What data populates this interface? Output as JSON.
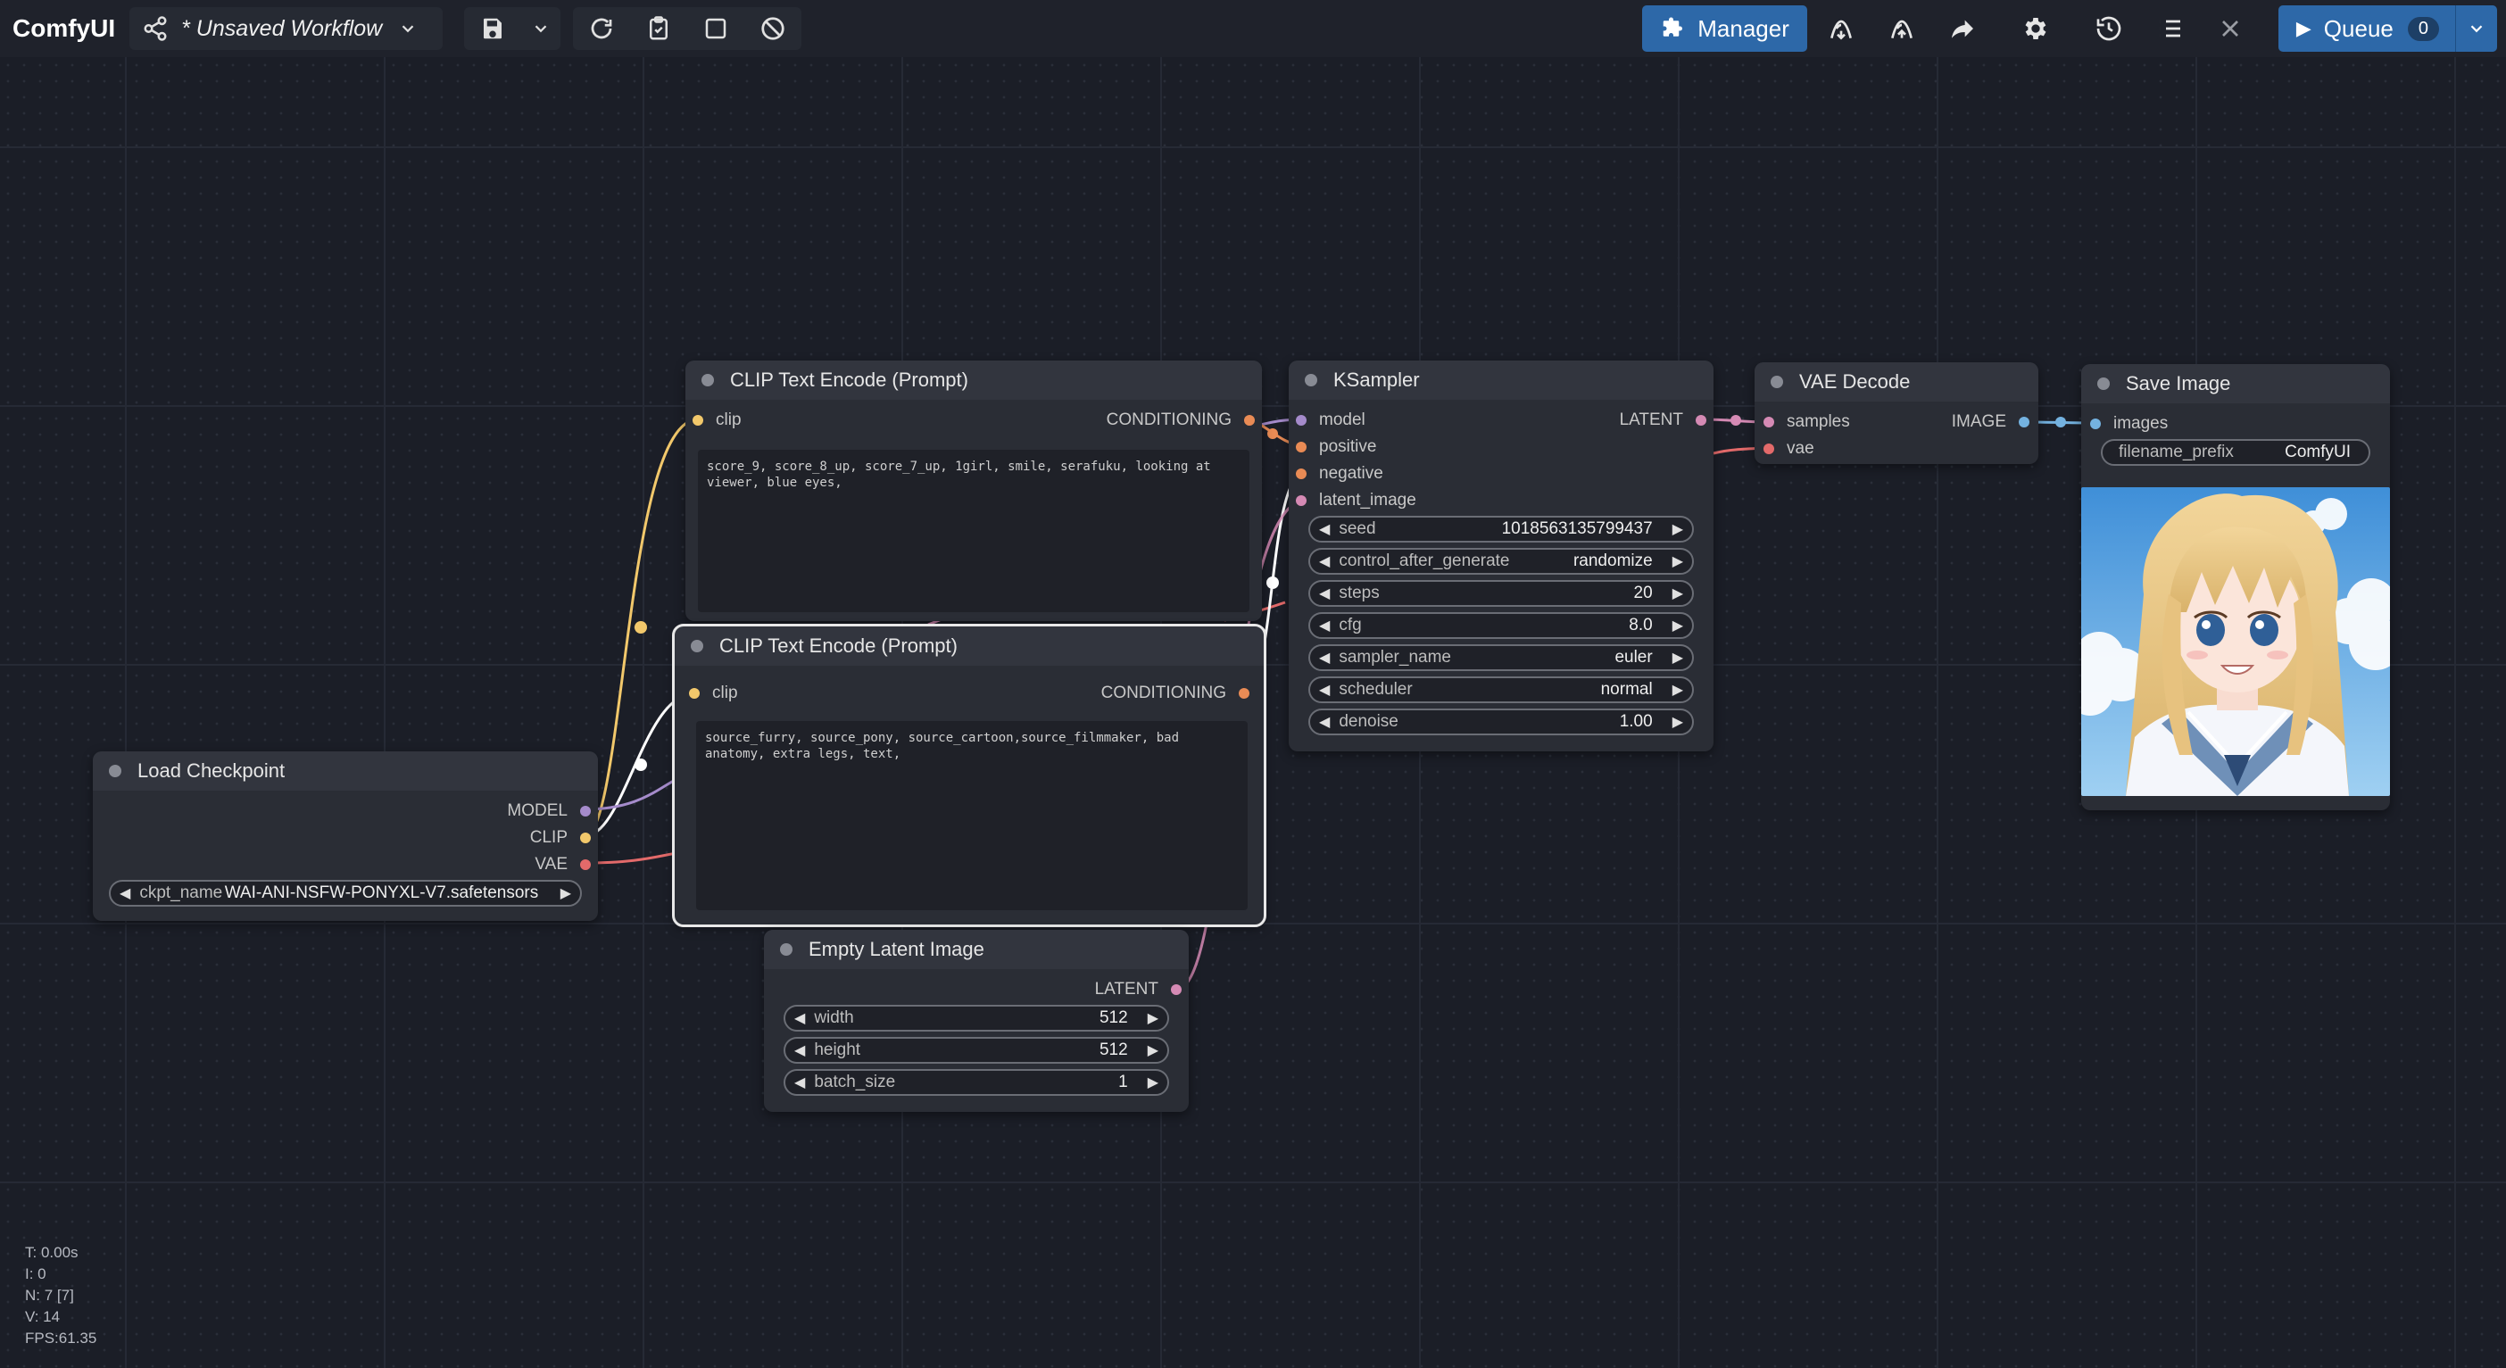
{
  "app": {
    "title": "ComfyUI"
  },
  "toolbar": {
    "workflow_name": "* Unsaved Workflow",
    "manager_label": "Manager",
    "queue_label": "Queue",
    "queue_count": "0",
    "icons": [
      "share-icon",
      "save-icon",
      "chevron-down-icon",
      "refresh-icon",
      "clipboard-icon",
      "fit-view-icon",
      "clear-icon",
      "puzzle-icon",
      "model-download-icon",
      "model-upload-icon",
      "share-arrow-icon",
      "settings-icon",
      "history-icon",
      "queue-list-icon",
      "close-icon",
      "play-icon"
    ]
  },
  "nodes": {
    "clip_pos": {
      "title": "CLIP Text Encode (Prompt)",
      "input": "clip",
      "output": "CONDITIONING",
      "text": "score_9, score_8_up, score_7_up, 1girl, smile, serafuku, looking at viewer, blue eyes,"
    },
    "clip_neg": {
      "title": "CLIP Text Encode (Prompt)",
      "input": "clip",
      "output": "CONDITIONING",
      "text": "source_furry, source_pony, source_cartoon,source_filmmaker, bad anatomy, extra legs, text,"
    },
    "ksampler": {
      "title": "KSampler",
      "inputs": [
        "model",
        "positive",
        "negative",
        "latent_image"
      ],
      "output": "LATENT",
      "widgets": [
        {
          "label": "seed",
          "value": "1018563135799437"
        },
        {
          "label": "control_after_generate",
          "value": "randomize"
        },
        {
          "label": "steps",
          "value": "20"
        },
        {
          "label": "cfg",
          "value": "8.0"
        },
        {
          "label": "sampler_name",
          "value": "euler"
        },
        {
          "label": "scheduler",
          "value": "normal"
        },
        {
          "label": "denoise",
          "value": "1.00"
        }
      ]
    },
    "vae_decode": {
      "title": "VAE Decode",
      "inputs": [
        "samples",
        "vae"
      ],
      "output": "IMAGE"
    },
    "save_image": {
      "title": "Save Image",
      "input": "images",
      "widget": {
        "label": "filename_prefix",
        "value": "ComfyUI"
      }
    },
    "load_checkpoint": {
      "title": "Load Checkpoint",
      "outputs": [
        "MODEL",
        "CLIP",
        "VAE"
      ],
      "widget": {
        "label": "ckpt_name",
        "value": "WAI-ANI-NSFW-PONYXL-V7.safetensors"
      }
    },
    "empty_latent": {
      "title": "Empty Latent Image",
      "output": "LATENT",
      "widgets": [
        {
          "label": "width",
          "value": "512"
        },
        {
          "label": "height",
          "value": "512"
        },
        {
          "label": "batch_size",
          "value": "1"
        }
      ]
    }
  },
  "stats": {
    "t": "T: 0.00s",
    "i": "I: 0",
    "n": "N: 7 [7]",
    "v": "V: 14",
    "fps": "FPS:61.35"
  },
  "colors": {
    "clip": "#f2c86b",
    "conditioning": "#e98b55",
    "model": "#a58bcb",
    "latent": "#d58ab4",
    "vae": "#e36a6a",
    "image": "#74b2e0",
    "accent": "#2d68a8"
  }
}
